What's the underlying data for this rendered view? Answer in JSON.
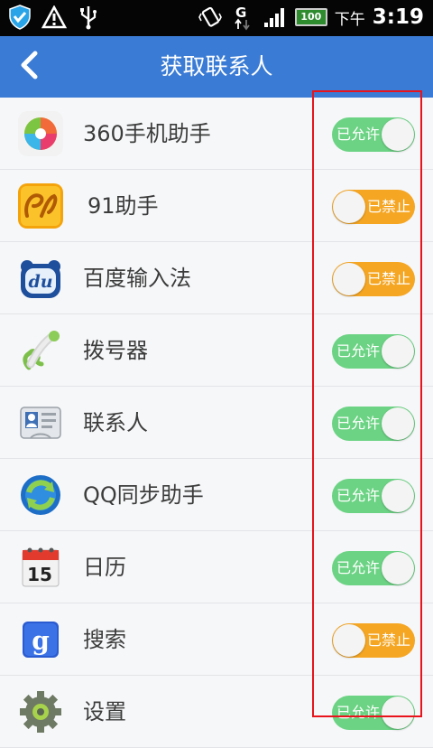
{
  "status_bar": {
    "ampm": "下午",
    "time": "3:19",
    "battery": "100",
    "icons": [
      "security-shield-icon",
      "warning-icon",
      "usb-icon",
      "vibrate-icon",
      "g-data-icon",
      "signal-icon",
      "battery-icon"
    ]
  },
  "header": {
    "title": "获取联系人",
    "back_icon": "back-arrow-icon"
  },
  "apps": [
    {
      "name": "360手机助手",
      "status": "已允许",
      "state": "allow",
      "icon": "app-360-icon"
    },
    {
      "name": "91助手",
      "status": "已禁止",
      "state": "deny",
      "icon": "app-91-icon"
    },
    {
      "name": "百度输入法",
      "status": "已禁止",
      "state": "deny",
      "icon": "baidu-du-icon"
    },
    {
      "name": "拨号器",
      "status": "已允许",
      "state": "allow",
      "icon": "phone-handset-icon"
    },
    {
      "name": "联系人",
      "status": "已允许",
      "state": "allow",
      "icon": "contact-card-icon"
    },
    {
      "name": "QQ同步助手",
      "status": "已允许",
      "state": "allow",
      "icon": "sync-arrows-icon"
    },
    {
      "name": "日历",
      "status": "已允许",
      "state": "allow",
      "icon": "calendar-icon"
    },
    {
      "name": "搜索",
      "status": "已禁止",
      "state": "deny",
      "icon": "google-search-icon"
    },
    {
      "name": "设置",
      "status": "已允许",
      "state": "allow",
      "icon": "gear-icon"
    }
  ],
  "calendar_icon_day": "15",
  "search_icon_letter": "g",
  "baidu_icon_text": "du",
  "colors": {
    "header": "#3a7bd5",
    "allow": "#6cd384",
    "deny": "#f5a623",
    "highlight": "#e8131b"
  }
}
